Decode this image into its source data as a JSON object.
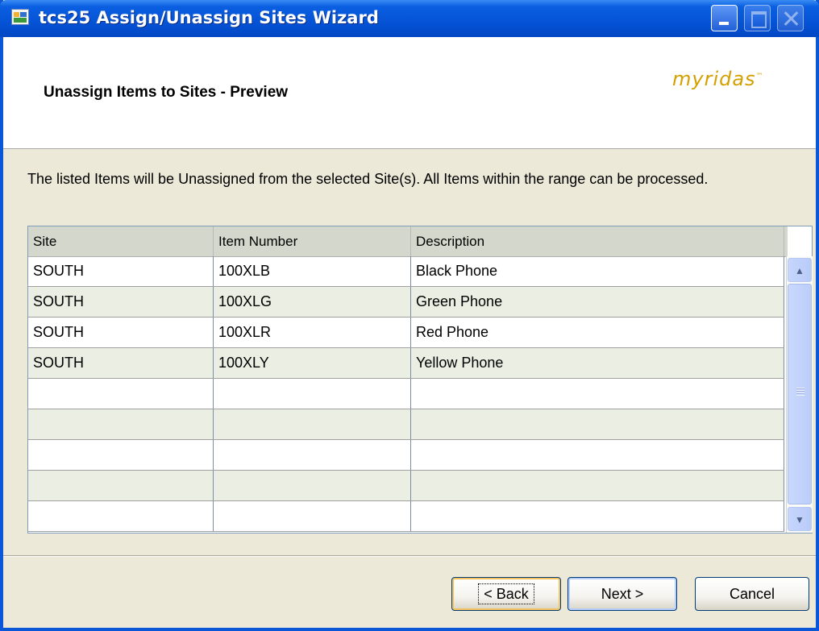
{
  "window": {
    "title": "tcs25 Assign/Unassign Sites Wizard",
    "accent_color": "#0553d6"
  },
  "titlebar_icons": [
    "app-icon",
    "minimize-icon",
    "maximize-icon",
    "close-icon"
  ],
  "header": {
    "title": "Unassign Items to Sites - Preview",
    "logo_text": "myridas",
    "logo_mark": "™",
    "logo_color": "#d4a000"
  },
  "description": "The listed Items will be Unassigned from the selected Site(s). All Items within the range can be processed.",
  "grid": {
    "columns": [
      "Site",
      "Item Number",
      "Description"
    ],
    "rows": [
      {
        "site": "SOUTH",
        "item": "100XLB",
        "desc": "Black Phone"
      },
      {
        "site": "SOUTH",
        "item": "100XLG",
        "desc": "Green Phone"
      },
      {
        "site": "SOUTH",
        "item": "100XLR",
        "desc": "Red Phone"
      },
      {
        "site": "SOUTH",
        "item": "100XLY",
        "desc": "Yellow Phone"
      },
      {
        "site": "",
        "item": "",
        "desc": ""
      },
      {
        "site": "",
        "item": "",
        "desc": ""
      },
      {
        "site": "",
        "item": "",
        "desc": ""
      },
      {
        "site": "",
        "item": "",
        "desc": ""
      },
      {
        "site": "",
        "item": "",
        "desc": ""
      }
    ],
    "scrollbar_icons": [
      "scroll-up-icon",
      "scroll-down-icon"
    ]
  },
  "buttons": {
    "back": "< Back",
    "next": "Next >",
    "cancel": "Cancel"
  }
}
